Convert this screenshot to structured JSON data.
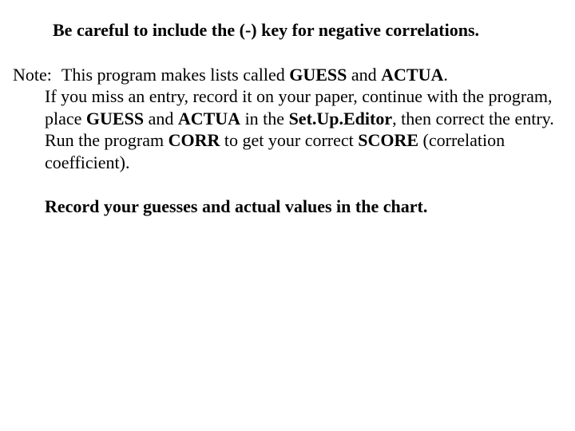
{
  "heading": "Be careful to include the (-) key for negative correlations.",
  "note": {
    "label": "Note:",
    "line1_pre": "This program makes lists called ",
    "guess1": "GUESS",
    "line1_mid": " and ",
    "actua1": "ACTUA",
    "line1_post": ".",
    "line2": "If you miss an entry, record it on your paper, continue with the program, place ",
    "guess2": "GUESS",
    "line2_mid": " and ",
    "actua2": "ACTUA",
    "line2_mid2": " in the ",
    "setup": "Set.Up.Editor",
    "line2_post": ", then correct the entry.  Run the program ",
    "corr": "CORR",
    "line3_mid": " to get your correct ",
    "score": "SCORE",
    "line3_post": " (correlation coefficient)."
  },
  "record": "Record your guesses and actual values in the chart."
}
